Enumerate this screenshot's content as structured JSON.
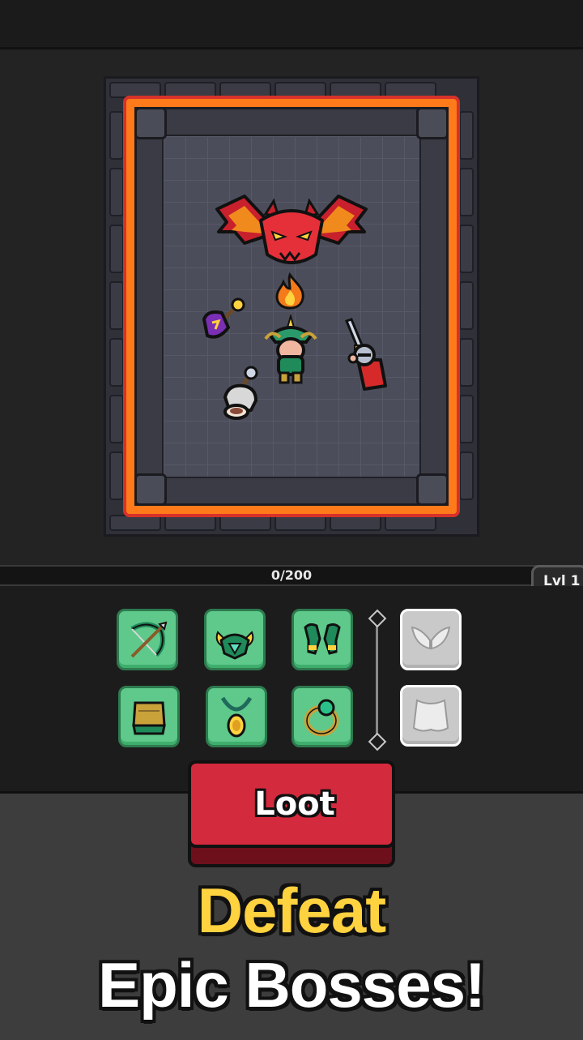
{
  "xp": {
    "progress_text": "0/200",
    "current": 0,
    "max": 200
  },
  "level": {
    "label": "Lvl 1"
  },
  "arena": {
    "boss": "red-dragon-boss",
    "effect": "fire-icon",
    "party": [
      "purple-mage-hero",
      "green-armored-leader-hero",
      "knight-hero-with-sword",
      "mace-warrior-hero"
    ]
  },
  "equipment": {
    "slots": [
      {
        "item": "bow-icon",
        "state": "owned"
      },
      {
        "item": "horned-helmet-icon",
        "state": "owned"
      },
      {
        "item": "gauntlets-icon",
        "state": "owned"
      },
      {
        "item": "wings-icon",
        "state": "locked"
      },
      {
        "item": "boots-icon",
        "state": "owned"
      },
      {
        "item": "amulet-icon",
        "state": "owned"
      },
      {
        "item": "ring-icon",
        "state": "owned"
      },
      {
        "item": "cape-icon",
        "state": "locked"
      }
    ]
  },
  "actions": {
    "loot_label": "Loot"
  },
  "promo": {
    "line1": "Defeat",
    "line2": "Epic Bosses!"
  },
  "colors": {
    "lava": "#f8a21b",
    "slot_owned": "#5ec98a",
    "slot_locked": "#c9c9c9",
    "loot_button": "#d42a3d",
    "promo_yellow": "#ffd23f"
  }
}
